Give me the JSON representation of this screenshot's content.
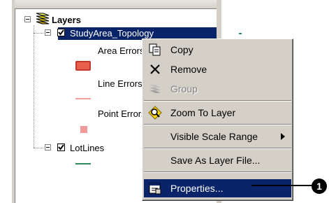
{
  "toc": {
    "root_label": "Layers",
    "layers": [
      {
        "name": "StudyArea_Topology",
        "selected": true,
        "checked": true,
        "legend": [
          {
            "label": "Area Errors",
            "symbol": "fill",
            "color": "#e8604c"
          },
          {
            "label": "Line Errors",
            "symbol": "line",
            "color": "#f4a09a"
          },
          {
            "label": "Point Errors",
            "symbol": "point",
            "color": "#f49a9a"
          }
        ]
      },
      {
        "name": "LotLines",
        "selected": false,
        "checked": true,
        "legend_symbol_color": "#2e8b57"
      }
    ]
  },
  "context_menu": {
    "items": [
      {
        "label": "Copy",
        "icon": "copy-icon",
        "enabled": true
      },
      {
        "label": "Remove",
        "icon": "remove-x-icon",
        "enabled": true
      },
      {
        "label": "Group",
        "icon": "group-icon",
        "enabled": false
      },
      {
        "label": "Zoom To Layer",
        "icon": "zoom-to-layer-icon",
        "enabled": true
      },
      {
        "label": "Visible Scale Range",
        "has_submenu": true,
        "enabled": true
      },
      {
        "label": "Save As Layer File...",
        "enabled": true
      },
      {
        "label": "Properties...",
        "icon": "properties-icon",
        "enabled": true,
        "highlighted": true
      }
    ]
  },
  "callout": {
    "number": "1"
  },
  "colors": {
    "selection": "#0a246a",
    "menu_bg": "#d4d0c8"
  }
}
